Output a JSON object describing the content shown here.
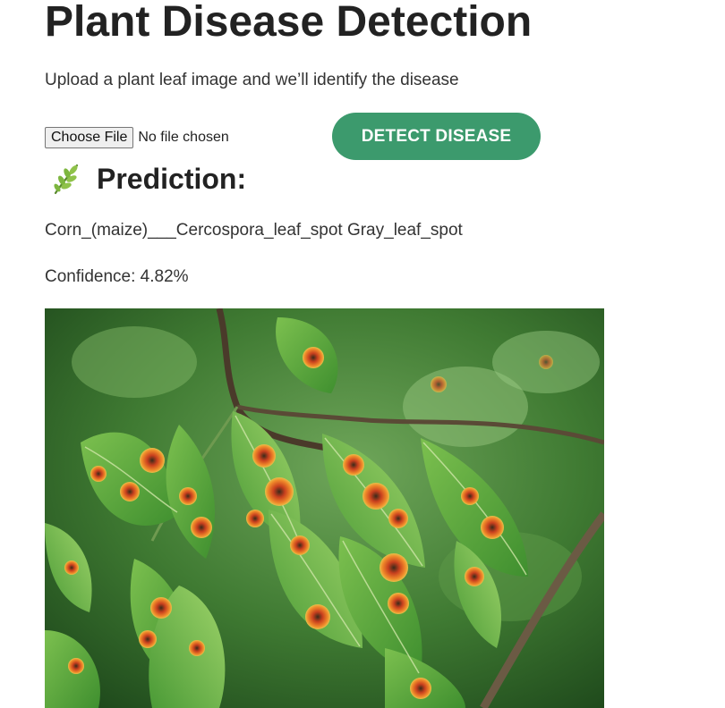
{
  "header": {
    "title": "Plant Disease Detection",
    "subtitle": "Upload a plant leaf image and we’ll identify the disease"
  },
  "upload": {
    "choose_label": "Choose File",
    "status": "No file chosen",
    "detect_label": "DETECT DISEASE"
  },
  "result": {
    "heading": "Prediction:",
    "icon": "herb-icon",
    "prediction": "Corn_(maize)___Cercospora_leaf_spot Gray_leaf_spot",
    "confidence": "Confidence: 4.82%"
  },
  "colors": {
    "accent": "#3c9a6d",
    "leaf_green": "#4f9e3a",
    "spot_orange": "#e0572a"
  }
}
